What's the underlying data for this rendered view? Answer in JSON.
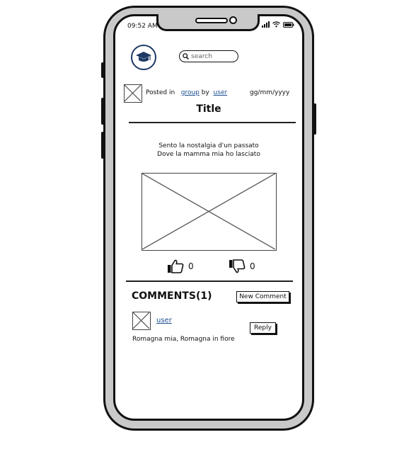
{
  "status_bar": {
    "time": "09:52 AM"
  },
  "header": {
    "logo_icon": "graduation-cap-icon",
    "search_placeholder": "search",
    "search_value": ""
  },
  "post": {
    "posted_in_label": "Posted in",
    "group_link": "group",
    "by_label": "by",
    "user_link": "user",
    "date": "gg/mm/yyyy",
    "title": "Title",
    "body_line1": "Sento la nostalgia d'un passato",
    "body_line2": "Dove la mamma mia ho lasciato",
    "likes": "0",
    "dislikes": "0"
  },
  "comments": {
    "heading": "COMMENTS(1)",
    "new_comment_label": "New Comment",
    "items": [
      {
        "user": "user",
        "text": "Romagna mia, Romagna in fiore",
        "reply_label": "Reply"
      }
    ]
  },
  "colors": {
    "link": "#1d4f91",
    "logo": "#1d3a66",
    "frame": "#c9c9c9"
  }
}
